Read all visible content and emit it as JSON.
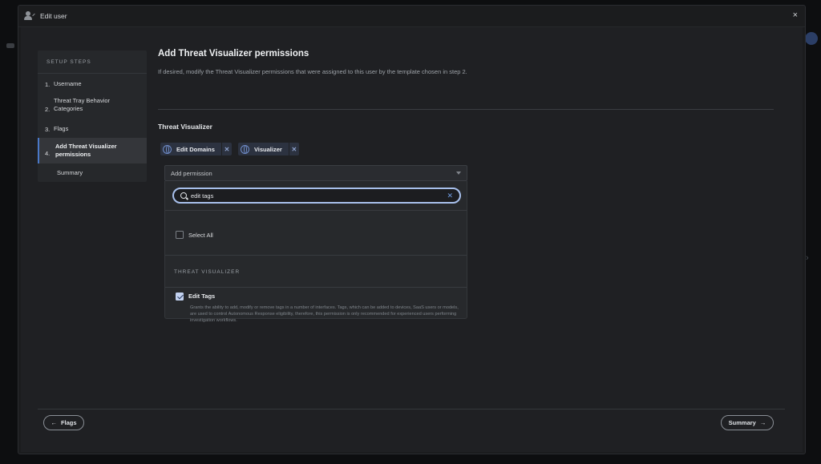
{
  "modal": {
    "title": "Edit user",
    "close_label": "×"
  },
  "steps": {
    "title": "SETUP STEPS",
    "items": [
      {
        "num": "1.",
        "label": "Username"
      },
      {
        "num": "2.",
        "label": "Threat Tray Behavior Categories"
      },
      {
        "num": "3.",
        "label": "Flags"
      },
      {
        "num": "4.",
        "label": "Add Threat Visualizer permissions"
      },
      {
        "num": "",
        "label": "Summary"
      }
    ],
    "active_index": 3
  },
  "main": {
    "title": "Add Threat Visualizer permissions",
    "description": "If desired, modify the Threat Visualizer permissions that were assigned to this user by the template chosen in step 2.",
    "section_title": "Threat Visualizer",
    "chips": [
      {
        "label": "Edit Domains",
        "icon": "globe-icon"
      },
      {
        "label": "Visualizer",
        "icon": "globe-icon"
      }
    ],
    "select_placeholder": "Add permission",
    "search_value": "edit tags",
    "select_all_label": "Select All",
    "group_title": "THREAT VISUALIZER",
    "permission": {
      "name": "Edit Tags",
      "checked": true,
      "description": "Grants the ability to add, modify or remove tags in a number of interfaces. Tags, which can be added to devices, SaaS users or models, are used to control Autonomous Response eligibility, therefore, this permission is only recommended for experienced users performing investigation workflows."
    }
  },
  "footer": {
    "back_label": "Flags",
    "next_label": "Summary"
  },
  "colors": {
    "accent": "#a8c0ec",
    "active_step_border": "#4a78c8",
    "modal_bg": "#1b1c1e"
  }
}
